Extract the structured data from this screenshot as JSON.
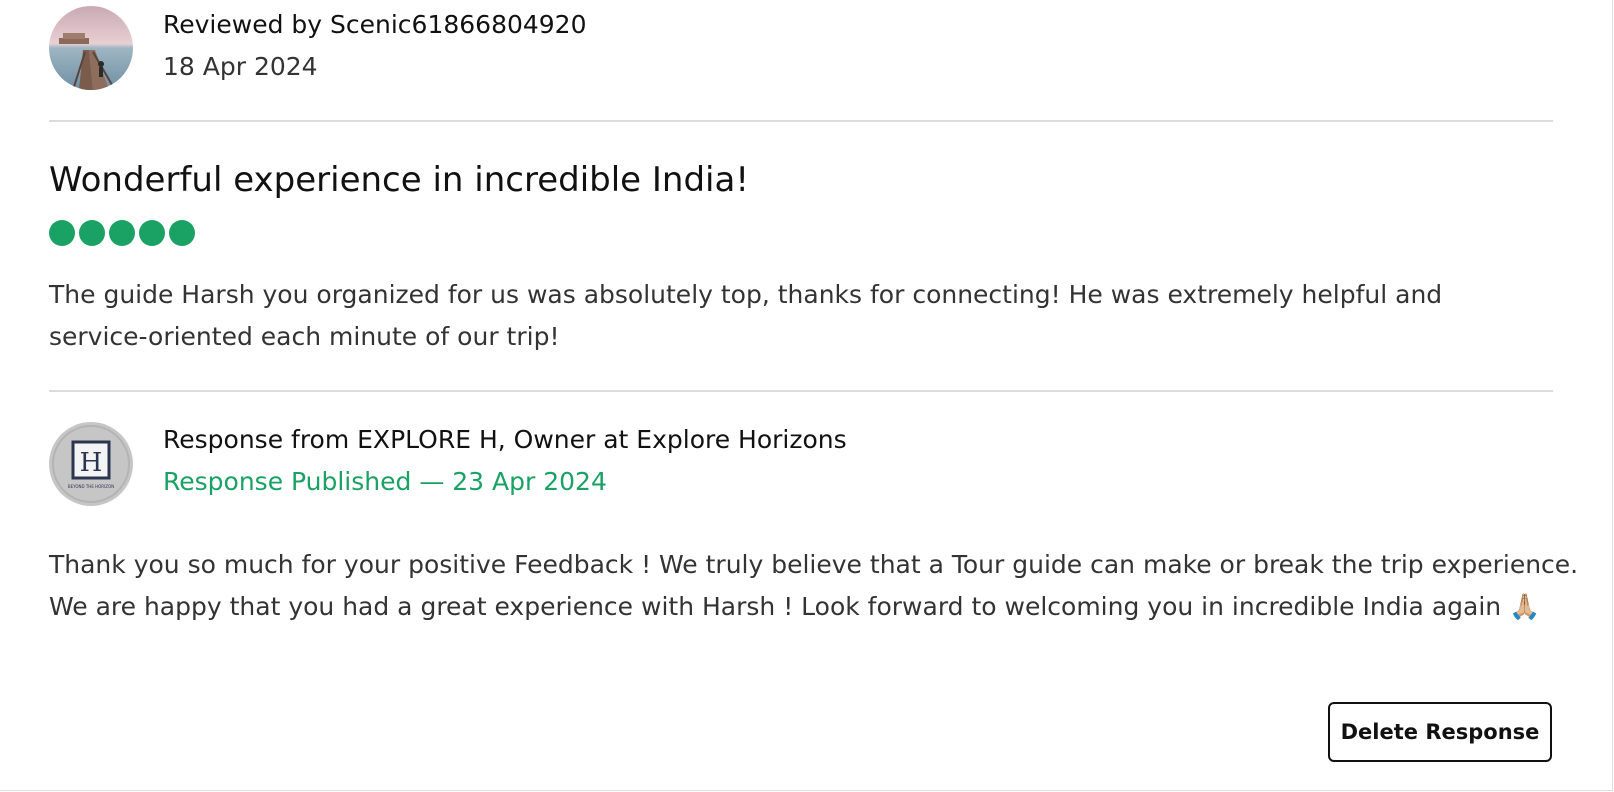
{
  "review": {
    "reviewer_line": "Reviewed by Scenic61866804920",
    "date": "18 Apr 2024",
    "title": "Wonderful experience in incredible India!",
    "rating": 5,
    "rating_max": 5,
    "rating_color": "#1aa164",
    "body": "The guide Harsh you organized for us was absolutely top, thanks for connecting! He was extremely helpful and service-oriented each minute of our trip!"
  },
  "response": {
    "from_line": "Response from EXPLORE H, Owner at Explore Horizons",
    "published_line": "Response Published — 23 Apr 2024",
    "published_color": "#1aa164",
    "body": "Thank you so much for your positive Feedback ! We truly believe that a Tour guide can make or break the trip experience. We are happy that you had a great experience with Harsh ! Look forward to welcoming you in incredible India again 🙏🏼",
    "logo_letter": "H",
    "logo_caption": "BEYOND THE HORIZON"
  },
  "actions": {
    "delete_label": "Delete Response"
  }
}
